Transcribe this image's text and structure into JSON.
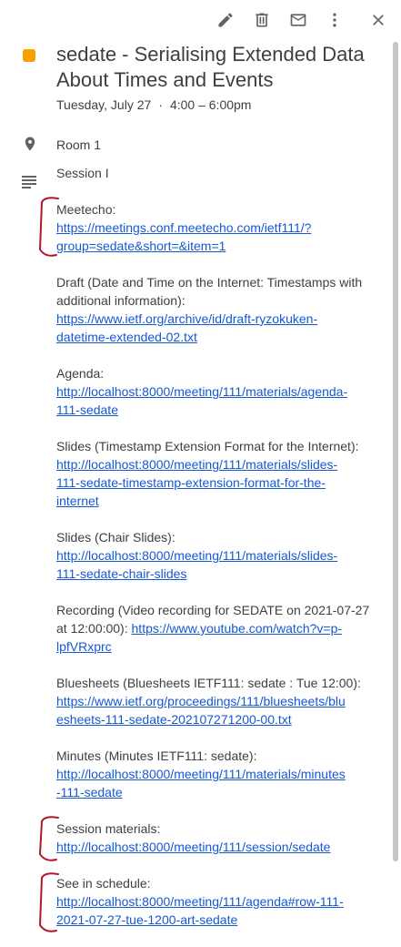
{
  "toolbar": {
    "icons": [
      "edit-icon",
      "delete-icon",
      "email-icon",
      "more-icon",
      "close-icon"
    ]
  },
  "event": {
    "title": "sedate - Serialising Extended Data About Times and Events",
    "date": "Tuesday, July 27",
    "separator": "·",
    "time": "4:00 – 6:00pm",
    "location": "Room 1",
    "color": "#f6a100"
  },
  "description": {
    "session": "Session I",
    "meetecho_label": "Meetecho:",
    "meetecho_link_1": "https://meetings.conf.meetecho.com/ietf111/?",
    "meetecho_link_2": "group=sedate&short=&item=1",
    "draft_label": "Draft (Date and Time on the Internet: Timestamps with additional information):",
    "draft_link_1": "https://www.ietf.org/archive/id/draft-ryzokuken-",
    "draft_link_2": "datetime-extended-02.txt",
    "agenda_label": "Agenda:",
    "agenda_link_1": "http://localhost:8000/meeting/111/materials/agenda-",
    "agenda_link_2": "111-sedate",
    "slides1_label": "Slides (Timestamp Extension Format for the Internet):",
    "slides1_link_1": "http://localhost:8000/meeting/111/materials/slides-",
    "slides1_link_2": "111-sedate-timestamp-extension-format-for-the-",
    "slides1_link_3": "internet",
    "slides2_label": "Slides (Chair Slides):",
    "slides2_link_1": "http://localhost:8000/meeting/111/materials/slides-",
    "slides2_link_2": "111-sedate-chair-slides",
    "recording_label_1": "Recording (Video recording for SEDATE on 2021-07-27",
    "recording_label_2": "at 12:00:00):",
    "recording_link_1": "https://www.youtube.com/watch?v=p-",
    "recording_link_2": "lpfVRxprc",
    "bluesheets_label": "Bluesheets (Bluesheets IETF111: sedate : Tue 12:00):",
    "bluesheets_link_1": "https://www.ietf.org/proceedings/111/bluesheets/blu",
    "bluesheets_link_2": "esheets-111-sedate-202107271200-00.txt",
    "minutes_label": "Minutes (Minutes IETF111: sedate):",
    "minutes_link_1": "http://localhost:8000/meeting/111/materials/minutes",
    "minutes_link_2": "-111-sedate",
    "session_materials_label": "Session materials:",
    "session_materials_link": "http://localhost:8000/meeting/111/session/sedate",
    "schedule_label": "See in schedule:",
    "schedule_link_1": "http://localhost:8000/meeting/111/agenda#row-111-",
    "schedule_link_2": "2021-07-27-tue-1200-art-sedate"
  },
  "annotation_color": "#b0182a"
}
